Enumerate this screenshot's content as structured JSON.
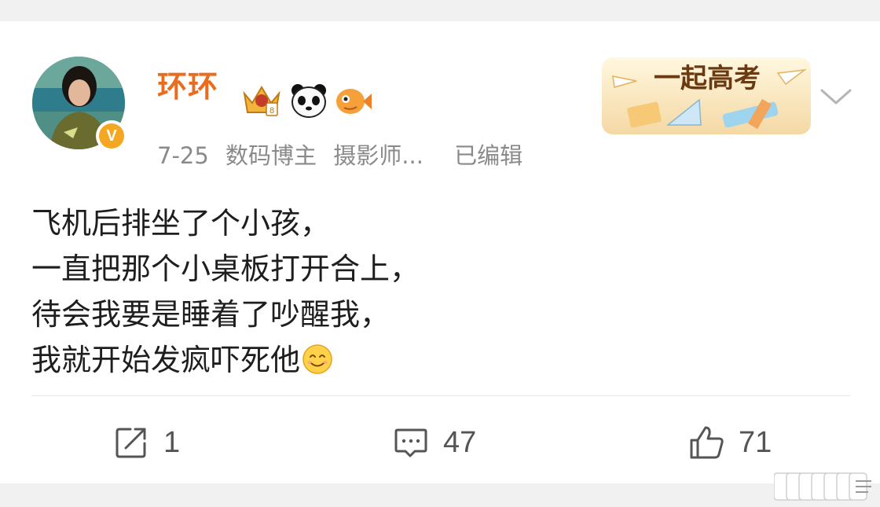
{
  "post": {
    "author": "环环",
    "meta": {
      "date": "7-25",
      "tags": [
        "数码博主",
        "摄影师..."
      ],
      "edited": "已编辑"
    },
    "banner_text": "一起高考",
    "lines": [
      "飞机后排坐了个小孩，",
      "一直把那个小桌板打开合上，",
      "待会我要是睡着了吵醒我，",
      "我就开始发疯吓死他"
    ],
    "trailing_emoji": "smile-emoji"
  },
  "actions": {
    "repost_count": "1",
    "comment_count": "47",
    "like_count": "71"
  },
  "badges": [
    "crown-badge-icon",
    "panda-badge-icon",
    "fish-badge-icon"
  ],
  "colors": {
    "username": "#e86d1f",
    "meta_text": "#8a8a8a",
    "body_text": "#1e1e1e",
    "action_text": "#555555",
    "verify_badge": "#f5a623",
    "background": "#f1f1f1"
  }
}
